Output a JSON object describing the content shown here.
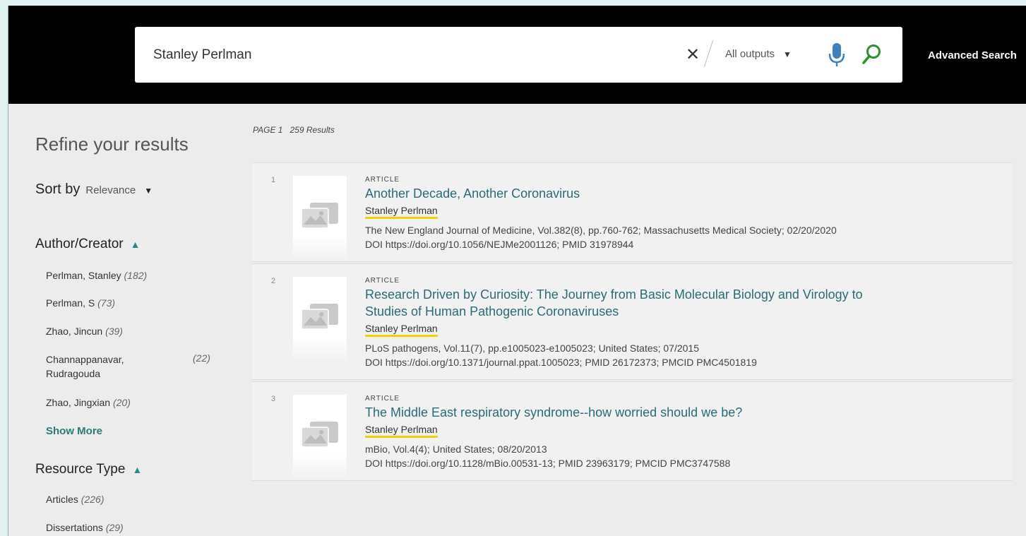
{
  "search": {
    "query": "Stanley Perlman",
    "clear_glyph": "✕",
    "scope": "All outputs",
    "advanced_label": "Advanced Search"
  },
  "sidebar": {
    "refine_title": "Refine your results",
    "sort_label": "Sort by",
    "sort_value": "Relevance",
    "author_facet": {
      "title": "Author/Creator",
      "items": [
        {
          "name": "Perlman, Stanley",
          "count": "(182)"
        },
        {
          "name": "Perlman, S",
          "count": "(73)"
        },
        {
          "name": "Zhao, Jincun",
          "count": "(39)"
        },
        {
          "name": "Channappanavar, Rudragouda",
          "count": "(22)"
        },
        {
          "name": "Zhao, Jingxian",
          "count": "(20)"
        }
      ],
      "show_more": "Show More"
    },
    "resource_facet": {
      "title": "Resource Type",
      "items": [
        {
          "name": "Articles",
          "count": "(226)"
        },
        {
          "name": "Dissertations",
          "count": "(29)"
        }
      ]
    }
  },
  "results_header": {
    "page": "PAGE 1",
    "count": "259 Results"
  },
  "results": [
    {
      "num": "1",
      "type": "ARTICLE",
      "title": "Another Decade, Another Coronavirus",
      "author": "Stanley Perlman",
      "source": "The New England Journal of Medicine, Vol.382(8), pp.760-762; Massachusetts Medical Society; 02/20/2020",
      "ids": "DOI https://doi.org/10.1056/NEJMe2001126; PMID 31978944"
    },
    {
      "num": "2",
      "type": "ARTICLE",
      "title": "Research Driven by Curiosity: The Journey from Basic Molecular Biology and Virology to Studies of Human Pathogenic Coronaviruses",
      "author": "Stanley Perlman",
      "source": "PLoS pathogens, Vol.11(7), pp.e1005023-e1005023; United States; 07/2015",
      "ids": "DOI https://doi.org/10.1371/journal.ppat.1005023; PMID 26172373; PMCID PMC4501819"
    },
    {
      "num": "3",
      "type": "ARTICLE",
      "title": "The Middle East respiratory syndrome--how worried should we be?",
      "author": "Stanley Perlman",
      "source": "mBio, Vol.4(4); United States; 08/20/2013",
      "ids": "DOI https://doi.org/10.1128/mBio.00531-13; PMID 23963179; PMCID PMC3747588"
    }
  ]
}
